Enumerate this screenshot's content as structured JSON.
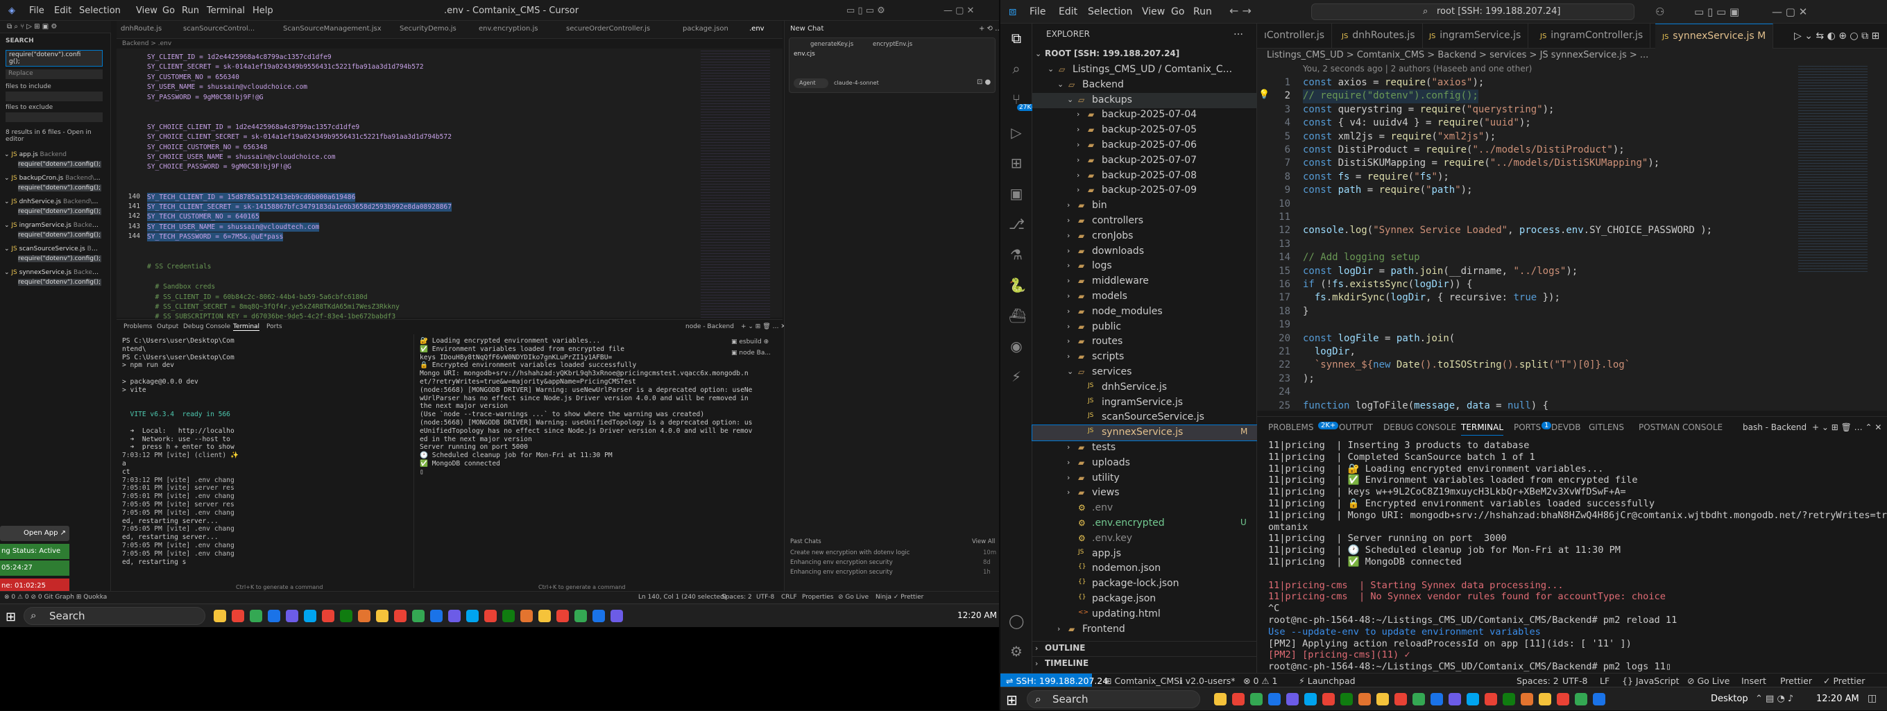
{
  "cursor": {
    "title": ".env - Comtanix_CMS - Cursor",
    "menu": [
      "File",
      "Edit",
      "Selection",
      "View",
      "Go",
      "Run",
      "Terminal",
      "Help"
    ],
    "tabs": [
      "dnhRoute.js",
      "scanSourceControl...",
      "ScanSourceManagement.jsx",
      "SecurityDemo.js",
      "env.encryption.js",
      "secureOrderController.js",
      "package.json",
      ".env"
    ],
    "chat_title": "New Chat",
    "chat_tabs": [
      "generateKey.js",
      "encryptEnv.js"
    ],
    "chat_context": "env.cjs",
    "chat_agent": "Agent",
    "chat_model": "claude-4-sonnet",
    "past_chats": "Past Chats",
    "view_all": "View All",
    "past_items": [
      {
        "t": "Create new encryption with dotenv logic",
        "d": "10m"
      },
      {
        "t": "Enhancing env encryption security",
        "d": "8d"
      },
      {
        "t": "Enhancing env encryption security",
        "d": "1h"
      }
    ],
    "breadcrumb": "Backend > .env",
    "search": {
      "label": "SEARCH",
      "query": "require(\"dotenv\").confi\ng();",
      "replace": "Replace",
      "files_include": "files to include",
      "files_exclude": "files to exclude",
      "summary": "8 results in 6 files - Open in editor",
      "results": [
        {
          "file": "app.js",
          "path": "Backend",
          "match": "require(\"dotenv\").config();"
        },
        {
          "file": "backupCron.js",
          "path": "Backend\\cro...",
          "match": "require(\"dotenv\").config();"
        },
        {
          "file": "dnhService.js",
          "path": "Backend\\se...",
          "match": "require(\"dotenv\").config();"
        },
        {
          "file": "ingramService.js",
          "path": "Backend\\...",
          "match": "require(\"dotenv\").config();"
        },
        {
          "file": "scanSourceService.js",
          "path": "Backend...",
          "match": "require(\"dotenv\").config();"
        },
        {
          "file": "synnexService.js",
          "path": "Backend\\...",
          "match": "require(\"dotenv\").config();"
        }
      ]
    },
    "editor": [
      {
        "n": "",
        "t": "SY_CLIENT_ID = 1d2e4425968a4c8799ac1357cd1dfe9"
      },
      {
        "n": "",
        "t": "SY_CLIENT_SECRET = sk-014a1ef19a024349b9556431c5221fba91aa3d1d794b572"
      },
      {
        "n": "",
        "t": "SY_CUSTOMER_NO = 656340"
      },
      {
        "n": "",
        "t": "SY_USER_NAME = shussain@vcloudchoice.com"
      },
      {
        "n": "",
        "t": "SY_PASSWORD = 9gM0C5B!bj9F!@G"
      },
      {
        "n": "",
        "t": ""
      },
      {
        "n": "",
        "t": ""
      },
      {
        "n": "",
        "t": "SY_CHOICE_CLIENT_ID = 1d2e4425968a4c8799ac1357cd1dfe9"
      },
      {
        "n": "",
        "t": "SY_CHOICE_CLIENT_SECRET = sk-014a1ef19a024349b9556431c5221fba91aa3d1d794b572"
      },
      {
        "n": "",
        "t": "SY_CHOICE_CUSTOMER_NO = 656348"
      },
      {
        "n": "",
        "t": "SY_CHOICE_USER_NAME = shussain@vcloudchoice.com"
      },
      {
        "n": "",
        "t": "SY_CHOICE_PASSWORD = 9gM0C5B!bj9F!@G"
      },
      {
        "n": "",
        "t": ""
      },
      {
        "n": "",
        "t": ""
      },
      {
        "n": "140",
        "t": "SY_TECH_CLIENT_ID = 15d8785a1512413eb9cd6b000a619486"
      },
      {
        "n": "141",
        "t": "SY_TECH_CLIENT_SECRET = sk-14158867bfc3479183da1e6b3658d2593b992e8da08928867"
      },
      {
        "n": "142",
        "t": "SY_TECH_CUSTOMER_NO = 640165"
      },
      {
        "n": "143",
        "t": "SY_TECH_USER_NAME = shussain@vcloudtech.com"
      },
      {
        "n": "144",
        "t": "SY_TECH_PASSWORD = 6=7M5&.@uE*pass"
      },
      {
        "n": "",
        "t": ""
      },
      {
        "n": "",
        "t": ""
      },
      {
        "n": "",
        "t": "# SS Credentials"
      },
      {
        "n": "",
        "t": ""
      },
      {
        "n": "",
        "t": "  # Sandbox creds"
      },
      {
        "n": "",
        "t": "  # SS_CLIENT_ID = 60b84c2c-8062-44b4-ba59-5a6cbfc6180d"
      },
      {
        "n": "",
        "t": "  # SS_CLIENT_SECRET = 8mq8Q~3fQf4r.ye5xZ4R8TKdA65mi7WesZ3Rkkny"
      },
      {
        "n": "",
        "t": "  # SS_SUBSCRIPTION_KEY = d67036be-9de5-4c2f-83e4-1be672babdf3"
      }
    ],
    "panel_tabs": [
      "Problems",
      "Output",
      "Debug Console",
      "Terminal",
      "Ports"
    ],
    "term_name": "node - Backend",
    "term1": [
      "PS C:\\Users\\user\\Desktop\\Com",
      "ntend\\",
      "PS C:\\Users\\user\\Desktop\\Com",
      "> npm run dev",
      "",
      "> package@0.0.0 dev",
      "> vite",
      "",
      "",
      "  VITE v6.3.4  ready in 566",
      "",
      "  ➜  Local:   http://localho",
      "  ➜  Network: use --host to",
      "  ➜  press h + enter to show",
      "7:03:12 PM [vite] (client) ✨",
      "a",
      "ct",
      "7:03:12 PM [vite] .env chang",
      "7:05:01 PM [vite] server res",
      "7:05:01 PM [vite] .env chang",
      "7:05:05 PM [vite] server res",
      "7:05:05 PM [vite] .env chang",
      "ed, restarting server...",
      "7:05:05 PM [vite] .env chang",
      "ed, restarting server...",
      "7:05:05 PM [vite] .env chang",
      "7:05:05 PM [vite] .env chang",
      "ed, restarting s"
    ],
    "term2": [
      "🔐 Loading encrypted environment variables...",
      "✅ Environment variables loaded from encrypted file",
      "keys IDouH8y8tNqQfF6vW0NDYDIko7gnKLuPrZI1y1AFBU=",
      "🔒 Encrypted environment variables loaded successfully",
      "Mongo URI: mongodb+srv://hshahzad:yQKbrL9qh3xRnoe@pricingcmstest.vqacc6x.mongodb.n",
      "et/?retryWrites=true&w=majority&appName=PricingCMSTest",
      "(node:5668) [MONGODB DRIVER] Warning: useNewUrlParser is a deprecated option: useNe",
      "wUrlParser has no effect since Node.js Driver version 4.0.0 and will be removed in",
      "the next major version",
      "(Use `node --trace-warnings ...` to show where the warning was created)",
      "(node:5668) [MONGODB DRIVER] Warning: useUnifiedTopology is a deprecated option: us",
      "eUnifiedTopology has no effect since Node.js Driver version 4.0.0 and will be remov",
      "ed in the next major version",
      "Server running on port 5000",
      "🕐 Scheduled cleanup job for Mon-Fri at 11:30 PM",
      "✅ MongoDB connected",
      "▯"
    ],
    "status": {
      "left": "⊗ 0 ⚠ 0  ⊘ 0    Git Graph    ⊞ Quokka",
      "pos": "Ln 140, Col 1 (240 selected)",
      "spaces": "Spaces: 2",
      "enc": "UTF-8",
      "eol": "CRLF",
      "lang": "Properties",
      "golive": "⊘ Go Live",
      "extra": "Ninja  ✓ Prettier",
      "cmd": "Ctrl+K to generate a command",
      "cmd2": "Ctrl+K to generate a command"
    },
    "left_panels": {
      "open_app": "Open App ↗",
      "status": "ng Status: Active",
      "timer1": "05:24:27",
      "timer2": "ne: 01:02:25"
    }
  },
  "taskbar_left": {
    "search": "Search",
    "time": "12:20 AM"
  },
  "vscode": {
    "menu": [
      "File",
      "Edit",
      "Selection",
      "View",
      "Go",
      "Run"
    ],
    "command_center": "root [SSH: 199.188.207.24]",
    "explorer_title": "EXPLORER",
    "root": "ROOT [SSH: 199.188.207.24]",
    "tree": [
      {
        "d": 1,
        "label": "Listings_CMS_UD / Comtanix_C...",
        "type": "folder-open"
      },
      {
        "d": 2,
        "label": "Backend",
        "type": "folder-open"
      },
      {
        "d": 3,
        "label": "backups",
        "type": "folder-open",
        "active": true
      },
      {
        "d": 4,
        "label": "backup-2025-07-04",
        "type": "folder"
      },
      {
        "d": 4,
        "label": "backup-2025-07-05",
        "type": "folder"
      },
      {
        "d": 4,
        "label": "backup-2025-07-06",
        "type": "folder"
      },
      {
        "d": 4,
        "label": "backup-2025-07-07",
        "type": "folder"
      },
      {
        "d": 4,
        "label": "backup-2025-07-08",
        "type": "folder"
      },
      {
        "d": 4,
        "label": "backup-2025-07-09",
        "type": "folder"
      },
      {
        "d": 3,
        "label": "bin",
        "type": "folder"
      },
      {
        "d": 3,
        "label": "controllers",
        "type": "folder"
      },
      {
        "d": 3,
        "label": "cronJobs",
        "type": "folder"
      },
      {
        "d": 3,
        "label": "downloads",
        "type": "folder"
      },
      {
        "d": 3,
        "label": "logs",
        "type": "folder"
      },
      {
        "d": 3,
        "label": "middleware",
        "type": "folder"
      },
      {
        "d": 3,
        "label": "models",
        "type": "folder"
      },
      {
        "d": 3,
        "label": "node_modules",
        "type": "folder"
      },
      {
        "d": 3,
        "label": "public",
        "type": "folder"
      },
      {
        "d": 3,
        "label": "routes",
        "type": "folder"
      },
      {
        "d": 3,
        "label": "scripts",
        "type": "folder"
      },
      {
        "d": 3,
        "label": "services",
        "type": "folder-open"
      },
      {
        "d": 4,
        "label": "dnhService.js",
        "type": "js"
      },
      {
        "d": 4,
        "label": "ingramService.js",
        "type": "js"
      },
      {
        "d": 4,
        "label": "scanSourceService.js",
        "type": "js"
      },
      {
        "d": 4,
        "label": "synnexService.js",
        "type": "js",
        "badge": "M",
        "selected": true
      },
      {
        "d": 3,
        "label": "tests",
        "type": "folder"
      },
      {
        "d": 3,
        "label": "uploads",
        "type": "folder"
      },
      {
        "d": 3,
        "label": "utility",
        "type": "folder"
      },
      {
        "d": 3,
        "label": "views",
        "type": "folder"
      },
      {
        "d": 3,
        "label": ".env",
        "type": "env"
      },
      {
        "d": 3,
        "label": ".env.encrypted",
        "type": "env",
        "badge": "U"
      },
      {
        "d": 3,
        "label": ".env.key",
        "type": "env"
      },
      {
        "d": 3,
        "label": "app.js",
        "type": "js"
      },
      {
        "d": 3,
        "label": "nodemon.json",
        "type": "json"
      },
      {
        "d": 3,
        "label": "package-lock.json",
        "type": "json"
      },
      {
        "d": 3,
        "label": "package.json",
        "type": "json"
      },
      {
        "d": 3,
        "label": "updating.html",
        "type": "html"
      },
      {
        "d": 2,
        "label": "Frontend",
        "type": "folder"
      }
    ],
    "outline": "OUTLINE",
    "timeline": "TIMELINE",
    "tabs": [
      {
        "label": "ıController.js",
        "active": false
      },
      {
        "label": "dnhRoutes.js",
        "active": false
      },
      {
        "label": "ingramService.js",
        "active": false
      },
      {
        "label": "ingramController.js",
        "active": false
      },
      {
        "label": "synnexService.js  M",
        "active": true
      }
    ],
    "breadcrumb": "Listings_CMS_UD > Comtanix_CMS > Backend > services > JS synnexService.js > ...",
    "blame": "You, 2 seconds ago | 2 authors (Haseeb and one other)",
    "code": [
      "const axios = require(\"axios\");",
      "// require(\"dotenv\").config();",
      "const querystring = require(\"querystring\");",
      "const { v4: uuidv4 } = require(\"uuid\");",
      "const xml2js = require(\"xml2js\");",
      "const DistiProduct = require(\"../models/DistiProduct\");",
      "const DistiSKUMapping = require(\"../models/DistiSKUMapping\");",
      "const fs = require(\"fs\");",
      "const path = require(\"path\");",
      "",
      "",
      "console.log(\"Synnex Service Loaded\", process.env.SY_CHOICE_PASSWORD );",
      "",
      "// Add logging setup",
      "const logDir = path.join(__dirname, \"../logs\");",
      "if (!fs.existsSync(logDir)) {",
      "  fs.mkdirSync(logDir, { recursive: true });",
      "}",
      "",
      "const logFile = path.join(",
      "  logDir,",
      "  `synnex_${new Date().toISOString().split(\"T\")[0]}.log`",
      ");",
      "",
      "function logToFile(message, data = null) {",
      "  const timestamp = new Date().toISOString();"
    ],
    "panel_tabs": [
      "PROBLEMS",
      "OUTPUT",
      "DEBUG CONSOLE",
      "TERMINAL",
      "PORTS",
      "DEVDB",
      "GITLENS",
      "POSTMAN CONSOLE"
    ],
    "problems_badge": "2K+",
    "ports_badge": "1",
    "term_label": "bash - Backend",
    "terminal": [
      "11|pricing  | Inserting 3 products to database",
      "11|pricing  | Completed ScanSource batch 1 of 1",
      "11|pricing  | 🔐 Loading encrypted environment variables...",
      "11|pricing  | ✅ Environment variables loaded from encrypted file",
      "11|pricing  | keys w++9L2CoC8Z19mxuycH3LkbQr+XBeM2v3XvWfDSwF+A=",
      "11|pricing  | 🔒 Encrypted environment variables loaded successfully",
      "11|pricing  | Mongo URI: mongodb+srv://hshahzad:bhaN8HZwQ4H86jCr@comtanix.wjtbdht.mongodb.net/?retryWrites=true&w=majority&appName=C",
      "omtanix",
      "11|pricing  | Server running on port  3000",
      "11|pricing  | 🕐 Scheduled cleanup job for Mon-Fri at 11:30 PM",
      "11|pricing  | ✅ MongoDB connected",
      "",
      "11|pricing-cms  | Starting Synnex data processing...",
      "11|pricing-cms  | No Synnex vendor rules found for accountType: choice",
      "^C",
      "root@nc-ph-1564-48:~/Listings_CMS_UD/Comtanix_CMS/Backend# pm2 reload 11",
      "Use --update-env to update environment variables",
      "[PM2] Applying action reloadProcessId on app [11](ids: [ '11' ])",
      "[PM2] [pricing-cms](11) ✓",
      "root@nc-ph-1564-48:~/Listings_CMS_UD/Comtanix_CMS/Backend# pm2 logs 11▯"
    ],
    "status": {
      "remote": "⇌ SSH: 199.188.207.24",
      "project": "⊞ Comtanix_CMS",
      "branch": "ℹ v2.0-users*",
      "sync": "⊗ 0 ⚠ 1",
      "launch": "⚡ Launchpad",
      "spaces": "Spaces: 2",
      "enc": "UTF-8",
      "eol": "LF",
      "lang": "{} JavaScript",
      "golive": "⊘ Go Live",
      "insert": "Insert",
      "prettier": "Prettier",
      "prettier2": "✓ Prettier"
    }
  },
  "taskbar_right": {
    "search": "Search",
    "desktop": "Desktop",
    "time": "12:20 AM"
  },
  "colors": {
    "accent": "#0078d4",
    "vite_green": "#4ec9b0",
    "status_blue": "#007acc"
  }
}
